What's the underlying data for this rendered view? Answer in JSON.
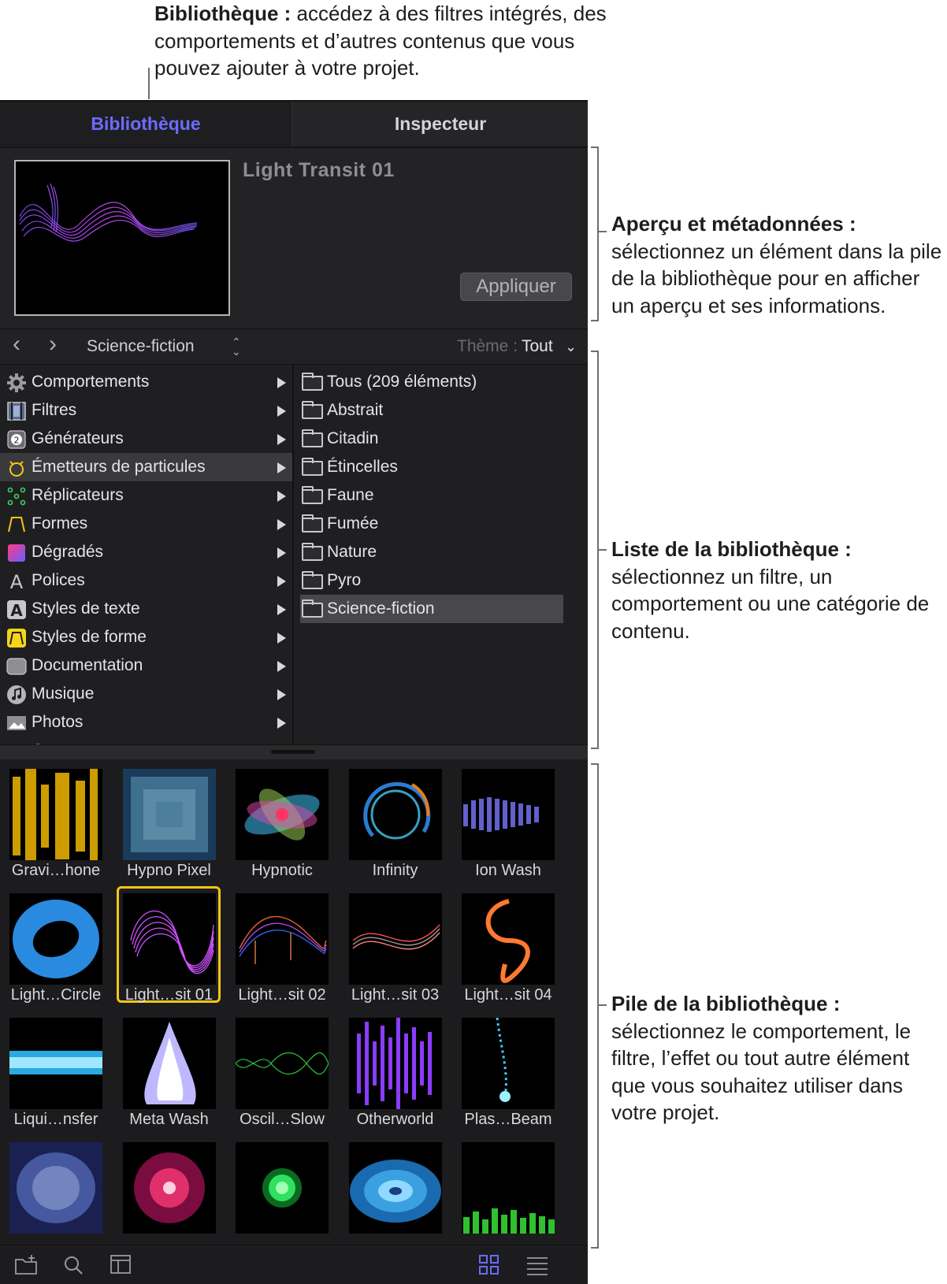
{
  "callouts": {
    "library": {
      "bold": "Bibliothèque :",
      "text": " accédez à des filtres intégrés, des comportements et d’autres contenus que vous pouvez ajouter à votre projet."
    },
    "preview": {
      "bold": "Aperçu et métadonnées :",
      "text": " sélectionnez un élément dans la pile de la bibliothèque pour en afficher un aperçu et ses informations."
    },
    "list": {
      "bold": "Liste de la bibliothèque :",
      "text": " sélectionnez un filtre, un comportement ou une catégorie de contenu."
    },
    "stack": {
      "bold": "Pile de la bibliothèque :",
      "text": " sélectionnez le comportement, le filtre, l’effet ou tout autre élément que vous souhaitez utiliser dans votre projet."
    }
  },
  "tabs": {
    "library": "Bibliothèque",
    "inspector": "Inspecteur"
  },
  "preview": {
    "title": "Light Transit 01",
    "apply_label": "Appliquer"
  },
  "navbar": {
    "back": "‹",
    "forward": "›",
    "category": "Science-fiction",
    "theme_label": "Thème :",
    "theme_value": "Tout"
  },
  "library_list": [
    {
      "label": "Comportements",
      "icon": "gear-icon"
    },
    {
      "label": "Filtres",
      "icon": "filmstrip-icon"
    },
    {
      "label": "Générateurs",
      "icon": "generator-icon"
    },
    {
      "label": "Émetteurs de particules",
      "icon": "emitter-icon",
      "selected": true
    },
    {
      "label": "Réplicateurs",
      "icon": "replicator-icon"
    },
    {
      "label": "Formes",
      "icon": "shape-icon"
    },
    {
      "label": "Dégradés",
      "icon": "gradient-icon"
    },
    {
      "label": "Polices",
      "icon": "font-icon"
    },
    {
      "label": "Styles de texte",
      "icon": "text-style-icon"
    },
    {
      "label": "Styles de forme",
      "icon": "shape-style-icon"
    },
    {
      "label": "Documentation",
      "icon": "documentation-icon"
    },
    {
      "label": "Musique",
      "icon": "music-icon"
    },
    {
      "label": "Photos",
      "icon": "photos-icon"
    },
    {
      "label": "Contenu",
      "icon": "folder-icon"
    }
  ],
  "subcategories": [
    {
      "label": "Tous (209 éléments)"
    },
    {
      "label": "Abstrait"
    },
    {
      "label": "Citadin"
    },
    {
      "label": "Étincelles"
    },
    {
      "label": "Faune"
    },
    {
      "label": "Fumée"
    },
    {
      "label": "Nature"
    },
    {
      "label": "Pyro"
    },
    {
      "label": "Science-fiction",
      "selected": true
    }
  ],
  "stack_items": [
    {
      "label": "Gravi…hone"
    },
    {
      "label": "Hypno Pixel"
    },
    {
      "label": "Hypnotic"
    },
    {
      "label": "Infinity"
    },
    {
      "label": "Ion Wash"
    },
    {
      "label": "Light…Circle"
    },
    {
      "label": "Light…sit 01",
      "selected": true
    },
    {
      "label": "Light…sit 02"
    },
    {
      "label": "Light…sit 03"
    },
    {
      "label": "Light…sit 04"
    },
    {
      "label": "Liqui…nsfer"
    },
    {
      "label": "Meta Wash"
    },
    {
      "label": "Oscil…Slow"
    },
    {
      "label": "Otherworld"
    },
    {
      "label": "Plas…Beam"
    },
    {
      "label": ""
    },
    {
      "label": ""
    },
    {
      "label": ""
    },
    {
      "label": ""
    },
    {
      "label": ""
    }
  ],
  "footer_buttons": [
    "new-folder-icon",
    "search-icon",
    "preview-toggle-icon",
    "grid-view-icon",
    "list-view-icon"
  ],
  "colors": {
    "accent": "#6b6bff",
    "selection": "#f5c518",
    "panel_bg": "#1c1c1e"
  }
}
